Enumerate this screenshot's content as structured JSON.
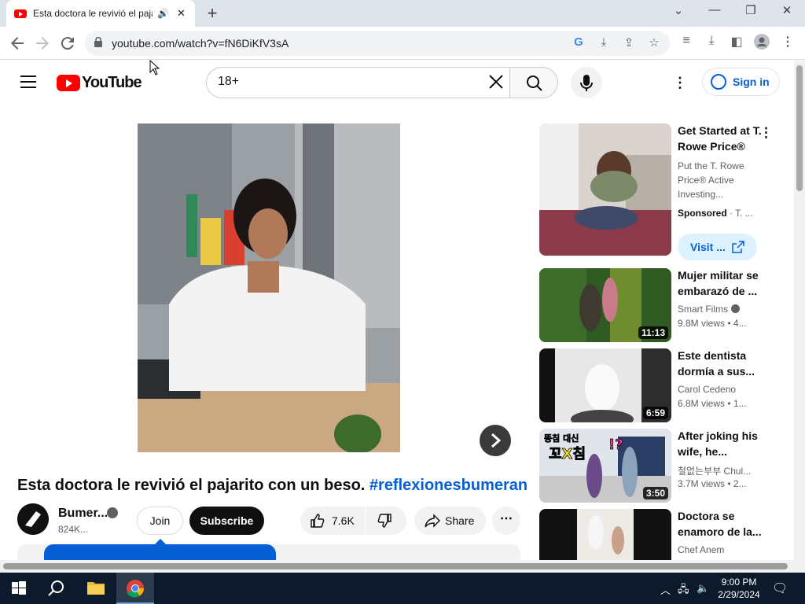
{
  "browser": {
    "tab_title": "Esta doctora le revivió el pajarito con un beso. #reflexionesbumeran",
    "url": "youtube.com/watch?v=fN6DiKfV3sA",
    "new_tab": "+",
    "minimize": "—",
    "restore": "❐",
    "close": "✕",
    "chevron": "⌄"
  },
  "masthead": {
    "logo_text": "YouTube",
    "search_value": "18+",
    "search_placeholder": "Search",
    "sign_in": "Sign in"
  },
  "video": {
    "title": "Esta doctora le revivió el pajarito con un beso.",
    "hashtag": "#reflexionesbumeran",
    "channel_name": "Bumer...",
    "subscribers": "824K...",
    "join": "Join",
    "subscribe": "Subscribe",
    "likes": "7.6K",
    "share": "Share"
  },
  "sidebar": {
    "ad": {
      "title": "Get Started at T. Rowe Price®",
      "description": "Put the T. Rowe Price® Active Investing...",
      "sponsored": "Sponsored",
      "advertiser": "T. ...",
      "visit": "Visit ..."
    },
    "items": [
      {
        "title": "Mujer militar se embarazó de ...",
        "channel": "Smart Films",
        "verified": true,
        "views": "9.8M views",
        "age": "4...",
        "duration": "11:13"
      },
      {
        "title": "Este dentista dormía a sus...",
        "channel": "Carol Cedeno",
        "verified": false,
        "views": "6.8M views",
        "age": "1...",
        "duration": "6:59"
      },
      {
        "title": "After joking his wife, he...",
        "channel": "철없는부부 Chul...",
        "verified": false,
        "views": "3.7M views",
        "age": "2...",
        "duration": "3:50",
        "thumb_text_1": "똥침 대신",
        "thumb_text_2": "꼬X침",
        "thumb_text_3": "!?"
      },
      {
        "title": "Doctora se enamoro de la...",
        "channel": "Chef Anem",
        "verified": false,
        "views": "",
        "age": "",
        "duration": ""
      }
    ]
  },
  "taskbar": {
    "time": "9:00 PM",
    "date": "2/29/2024"
  },
  "colors": {
    "yt_red": "#ff0000",
    "link_blue": "#065fd4",
    "taskbar": "#0c1a2b"
  }
}
